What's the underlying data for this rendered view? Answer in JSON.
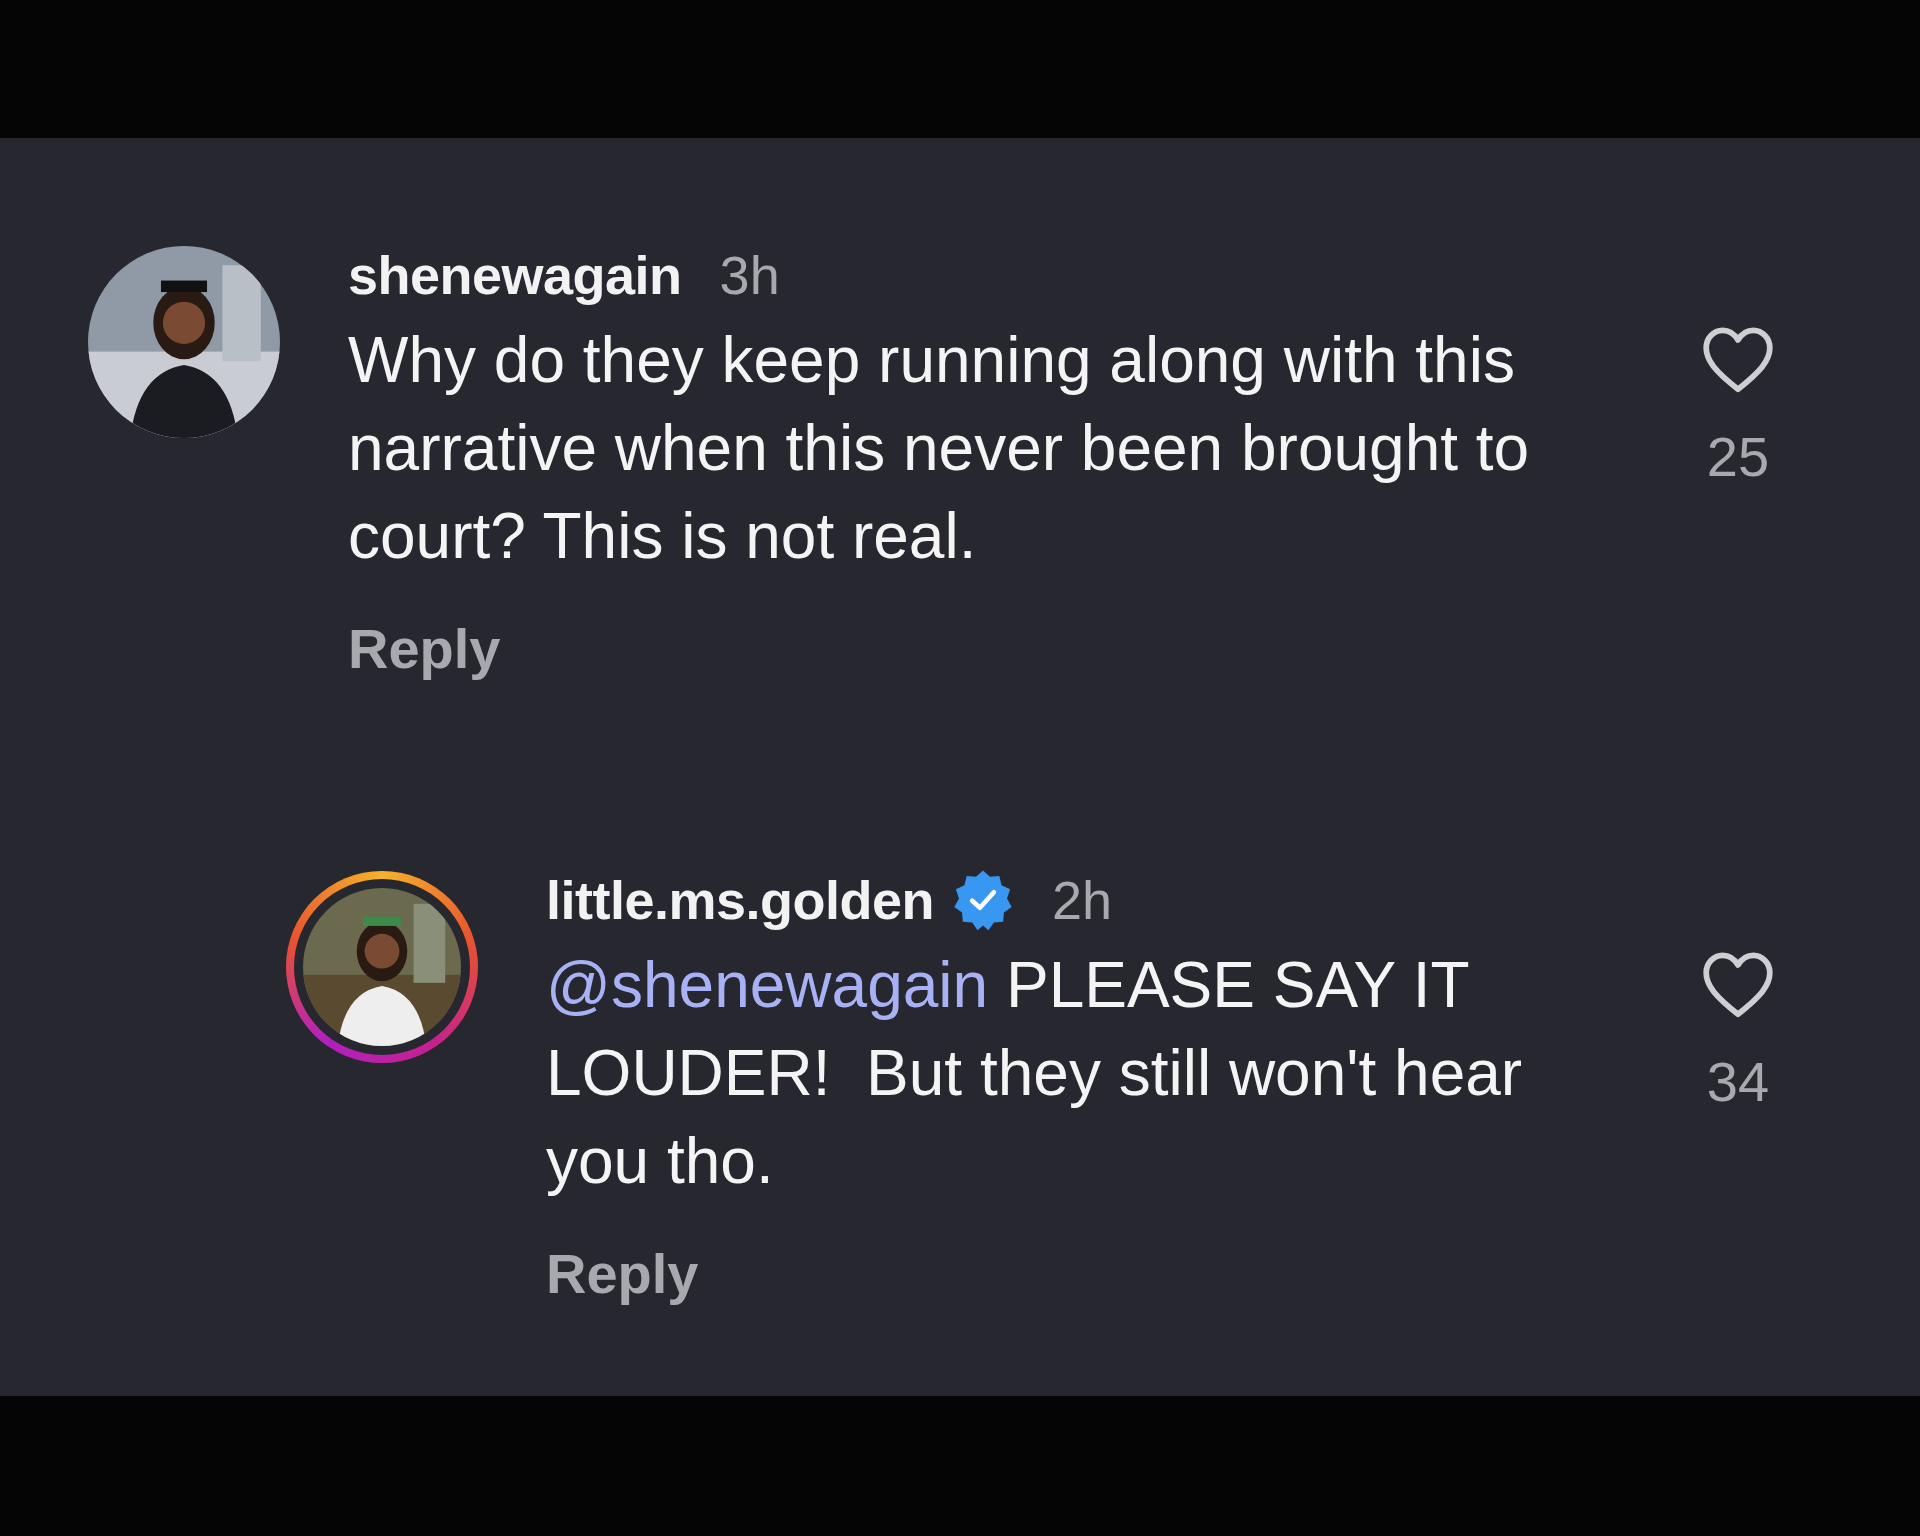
{
  "comments": [
    {
      "avatar": {
        "kind": "picture",
        "story_ring": false
      },
      "username": "shenewagain",
      "verified": false,
      "time": "3h",
      "text": "Why do they keep running along with this narrative when this never been brought to court? This is not real.",
      "liked": false,
      "likes": "25",
      "reply_label": "Reply",
      "replies": [
        {
          "avatar": {
            "kind": "picture",
            "story_ring": true
          },
          "username": "little.ms.golden",
          "verified": true,
          "time": "2h",
          "mention": "@shenewagain",
          "text": "PLEASE SAY IT LOUDER!  But they still won't hear you tho.",
          "liked": false,
          "likes": "34",
          "reply_label": "Reply"
        }
      ]
    }
  ]
}
